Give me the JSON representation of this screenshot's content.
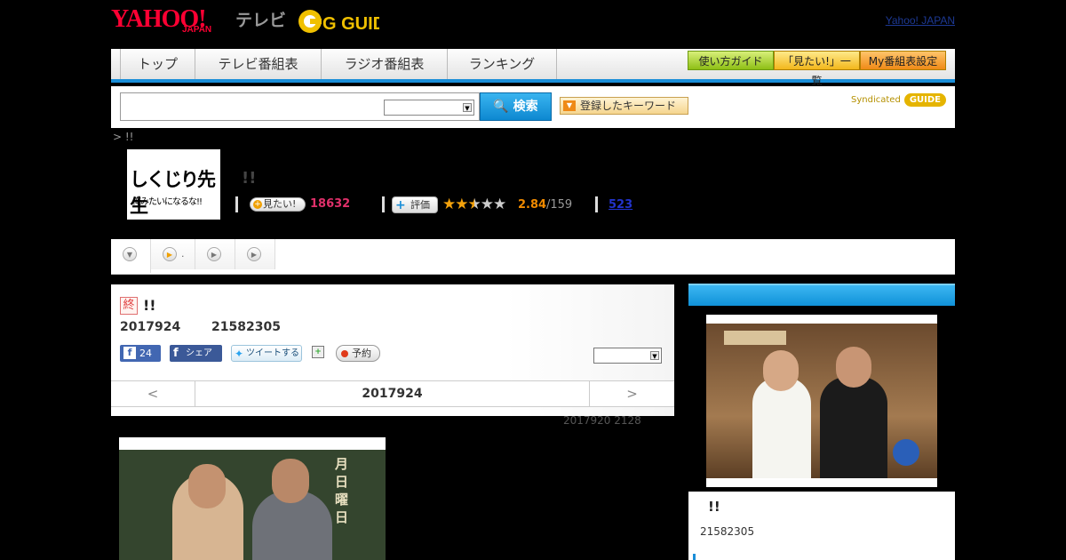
{
  "header": {
    "logo_yahoo": "YAHOO!",
    "logo_japan": "JAPAN",
    "logo_tv": "テレビ",
    "logo_gguide": "G GUIDE",
    "yahoo_japan_link": "Yahoo! JAPAN"
  },
  "nav": {
    "tabs": [
      {
        "label": "トップ"
      },
      {
        "label": "テレビ番組表"
      },
      {
        "label": "ラジオ番組表"
      },
      {
        "label": "ランキング"
      }
    ],
    "guide_button": "使い方ガイド",
    "want_list_button": "「見たい!」一覧",
    "my_schedule_button": "My番組表設定"
  },
  "search": {
    "input_value": "",
    "select_value": "",
    "search_button": "検索",
    "keyword_button": "登録したキーワード",
    "syndicated_label": "Syndicated",
    "syndicated_brand": "GUIDE"
  },
  "breadcrumb": "> !!",
  "program": {
    "thumb_title": "しくじり先生",
    "thumb_subtitle": "俺みたいになるな!!",
    "title": "!!",
    "want_label": "見たい!",
    "want_count": "18632",
    "rate_label": "評価",
    "rating_value": 2.84,
    "score": "2.84",
    "score_sub": "/159",
    "reviews": "523"
  },
  "subtabs": [
    {
      "label": "",
      "icon": "chevron-down-icon"
    },
    {
      "label": ".",
      "icon": "play-icon"
    },
    {
      "label": "",
      "icon": "play-icon"
    },
    {
      "label": "",
      "icon": "play-icon"
    }
  ],
  "episode": {
    "badge": "終",
    "title": "!!",
    "date": "2017924",
    "time": "21582305",
    "fb_like_count": "24",
    "fb_share_label": "シェア",
    "tweet_label": "ツイートする",
    "reserve_label": "予約",
    "select_value": "",
    "nav_prev": "<",
    "nav_date": "2017924",
    "nav_next": ">",
    "update_note": "2017920  2128"
  },
  "main_image": {
    "board_text": "月日曜日"
  },
  "side": {
    "title": "!!",
    "time": "21582305"
  },
  "colors": {
    "accent_blue": "#1a8ed8",
    "want_pink": "#e0306a",
    "star_orange": "#f3a20c",
    "yahoo_red": "#ff0033"
  }
}
